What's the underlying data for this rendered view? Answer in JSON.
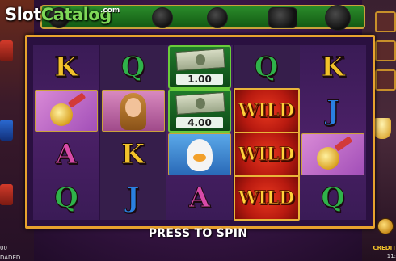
{
  "watermark": {
    "brand_left": "Slot",
    "brand_right": "Catalog",
    "brand_suffix": ".com"
  },
  "reels": [
    {
      "cells": [
        {
          "type": "letter",
          "value": "K"
        },
        {
          "type": "picture",
          "icon": "potion-icon"
        },
        {
          "type": "letter",
          "value": "A"
        },
        {
          "type": "letter",
          "value": "Q"
        }
      ]
    },
    {
      "cells": [
        {
          "type": "letter",
          "value": "Q"
        },
        {
          "type": "picture",
          "icon": "woman-portrait-icon"
        },
        {
          "type": "letter",
          "value": "K"
        },
        {
          "type": "letter",
          "value": "J"
        }
      ]
    },
    {
      "cells": [
        {
          "type": "money",
          "value": "1.00"
        },
        {
          "type": "money",
          "value": "4.00"
        },
        {
          "type": "picture",
          "icon": "goose-icon"
        },
        {
          "type": "letter",
          "value": "A"
        }
      ]
    },
    {
      "cells": [
        {
          "type": "letter",
          "value": "Q"
        },
        {
          "type": "wild",
          "value": "WILD"
        },
        {
          "type": "wild",
          "value": "WILD"
        },
        {
          "type": "wild",
          "value": "WILD"
        }
      ]
    },
    {
      "cells": [
        {
          "type": "letter",
          "value": "K"
        },
        {
          "type": "letter",
          "value": "J"
        },
        {
          "type": "picture",
          "icon": "potion-icon"
        },
        {
          "type": "letter",
          "value": "Q"
        }
      ]
    }
  ],
  "status": {
    "message": "PRESS TO SPIN"
  },
  "footer": {
    "left_value": "00",
    "left_status": "DADED",
    "credit_label": "CREDIT",
    "clock": "11:"
  },
  "colors": {
    "frame": "#e7a22e",
    "wild": "#e8371e",
    "letter_K": "#f2c22a",
    "letter_Q": "#2fb24a",
    "letter_A": "#d84aa8",
    "letter_J": "#2a80e0"
  }
}
